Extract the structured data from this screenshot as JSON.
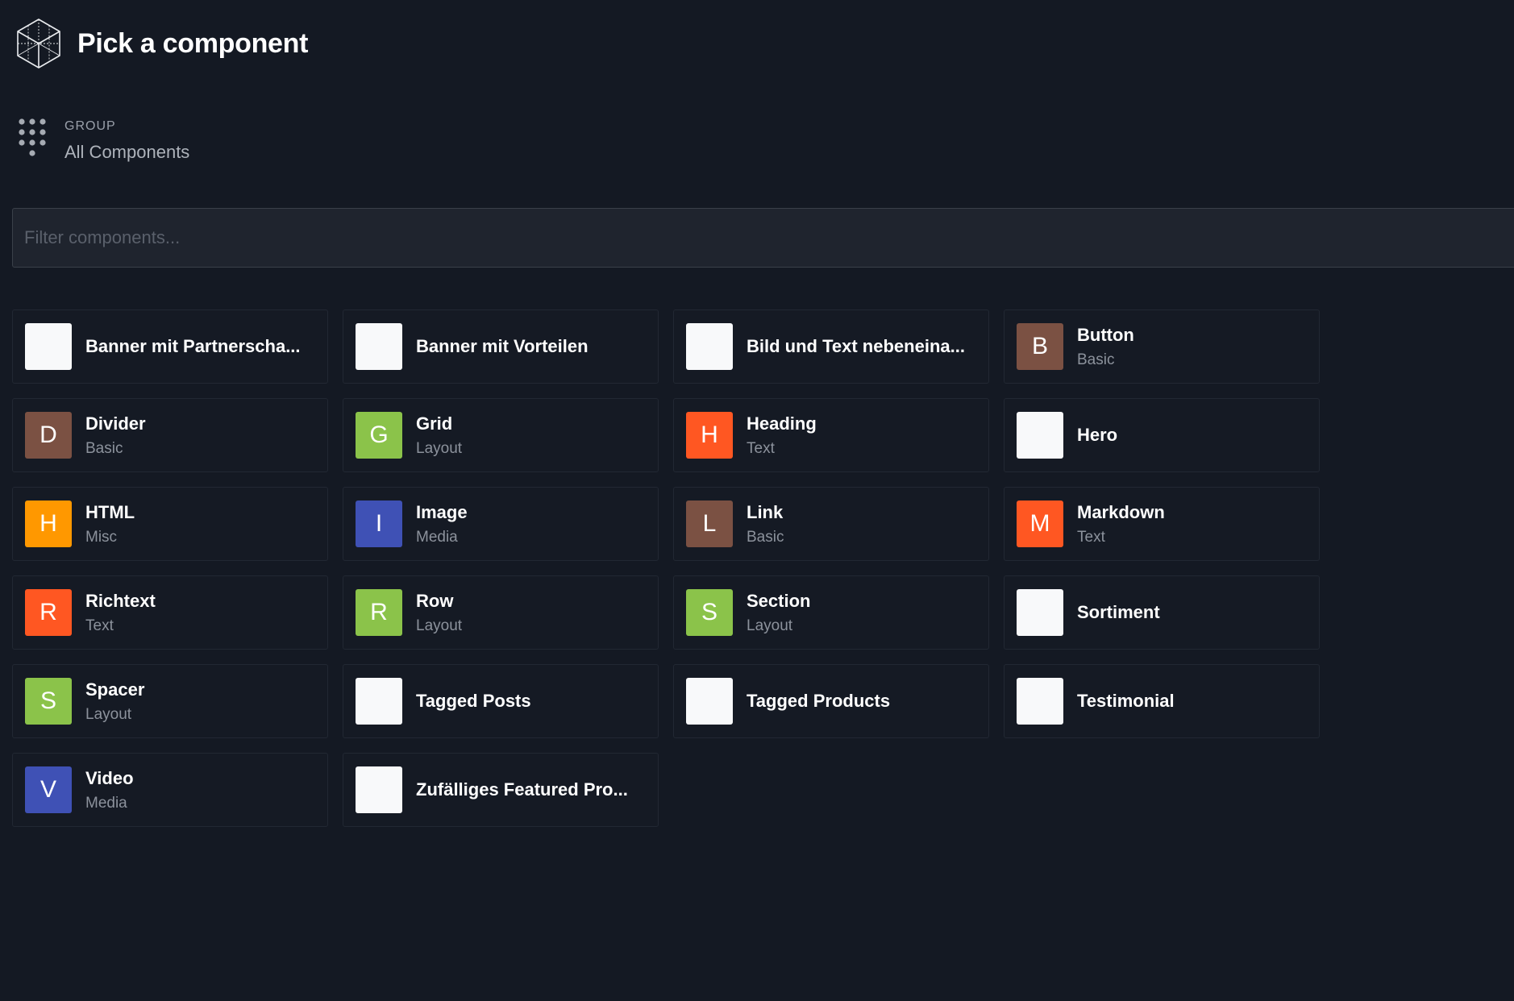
{
  "header": {
    "title": "Pick a component",
    "logo_icon": "cube-icon"
  },
  "group": {
    "label": "Group",
    "value": "All Components",
    "icon": "dots-grid-icon"
  },
  "filter": {
    "placeholder": "Filter components...",
    "value": ""
  },
  "colors": {
    "background": "#141923",
    "card_background": "#151a24",
    "basic": "#7b5143",
    "layout": "#8bc34a",
    "text": "#ff5722",
    "misc": "#ff9800",
    "media": "#3f51b5",
    "no_category": "#f8f9fa"
  },
  "components": [
    {
      "name": "Banner mit Partnerscha...",
      "category": "",
      "initial": "",
      "color": "#f8f9fa"
    },
    {
      "name": "Banner mit Vorteilen",
      "category": "",
      "initial": "",
      "color": "#f8f9fa"
    },
    {
      "name": "Bild und Text nebeneina...",
      "category": "",
      "initial": "",
      "color": "#f8f9fa"
    },
    {
      "name": "Button",
      "category": "Basic",
      "initial": "B",
      "color": "#7b5143"
    },
    {
      "name": "Divider",
      "category": "Basic",
      "initial": "D",
      "color": "#7b5143"
    },
    {
      "name": "Grid",
      "category": "Layout",
      "initial": "G",
      "color": "#8bc34a"
    },
    {
      "name": "Heading",
      "category": "Text",
      "initial": "H",
      "color": "#ff5722"
    },
    {
      "name": "Hero",
      "category": "",
      "initial": "",
      "color": "#f8f9fa"
    },
    {
      "name": "HTML",
      "category": "Misc",
      "initial": "H",
      "color": "#ff9800"
    },
    {
      "name": "Image",
      "category": "Media",
      "initial": "I",
      "color": "#3f51b5"
    },
    {
      "name": "Link",
      "category": "Basic",
      "initial": "L",
      "color": "#7b5143"
    },
    {
      "name": "Markdown",
      "category": "Text",
      "initial": "M",
      "color": "#ff5722"
    },
    {
      "name": "Richtext",
      "category": "Text",
      "initial": "R",
      "color": "#ff5722"
    },
    {
      "name": "Row",
      "category": "Layout",
      "initial": "R",
      "color": "#8bc34a"
    },
    {
      "name": "Section",
      "category": "Layout",
      "initial": "S",
      "color": "#8bc34a"
    },
    {
      "name": "Sortiment",
      "category": "",
      "initial": "",
      "color": "#f8f9fa"
    },
    {
      "name": "Spacer",
      "category": "Layout",
      "initial": "S",
      "color": "#8bc34a"
    },
    {
      "name": "Tagged Posts",
      "category": "",
      "initial": "",
      "color": "#f8f9fa"
    },
    {
      "name": "Tagged Products",
      "category": "",
      "initial": "",
      "color": "#f8f9fa"
    },
    {
      "name": "Testimonial",
      "category": "",
      "initial": "",
      "color": "#f8f9fa"
    },
    {
      "name": "Video",
      "category": "Media",
      "initial": "V",
      "color": "#3f51b5"
    },
    {
      "name": "Zufälliges Featured Pro...",
      "category": "",
      "initial": "",
      "color": "#f8f9fa"
    }
  ]
}
